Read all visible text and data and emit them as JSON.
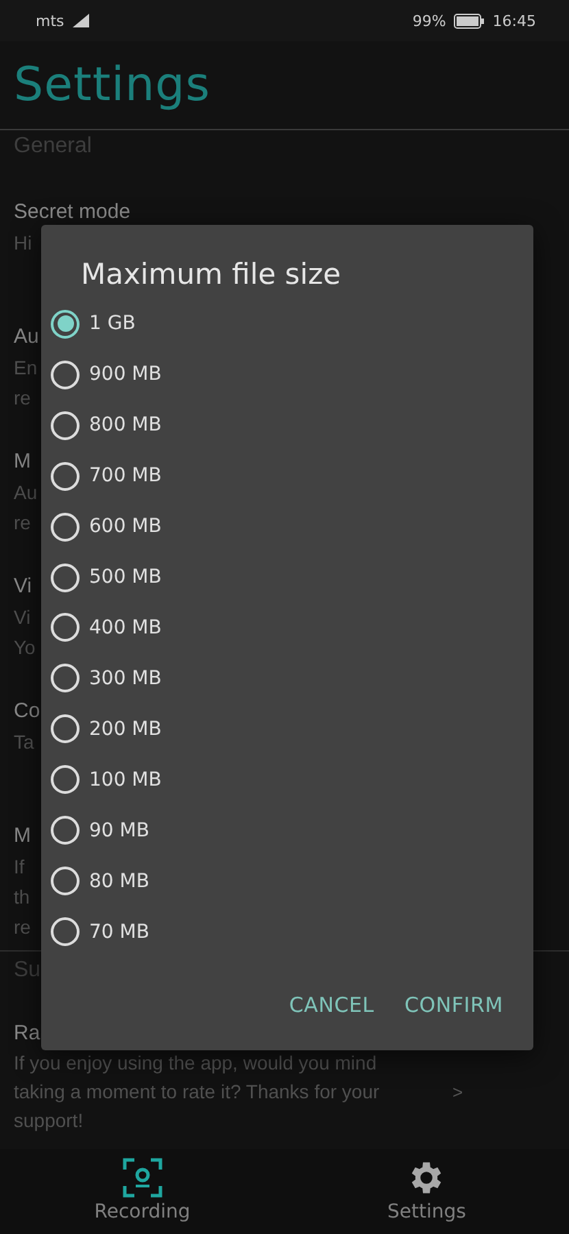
{
  "status_bar": {
    "carrier": "mts",
    "battery": "99%",
    "time": "16:45"
  },
  "header": {
    "title": "Settings"
  },
  "section": "General",
  "items": [
    {
      "title": "Secret mode",
      "lines": [
        "Hi"
      ]
    },
    {
      "title": "Au",
      "lines": [
        "En",
        "re"
      ]
    },
    {
      "title": "M",
      "lines": [
        "Au",
        "re"
      ]
    },
    {
      "title": "Vi",
      "lines": [
        "Vi",
        "Yo"
      ]
    },
    {
      "title": "Co",
      "lines": [
        "Ta"
      ]
    },
    {
      "title": "M",
      "lines": [
        "If",
        "th",
        "re"
      ]
    }
  ],
  "section_2": "Su",
  "rate": {
    "title": "Ra",
    "text": "If you enjoy using the app, would you mind taking a moment to rate it? Thanks for your support!",
    "chevron": ">"
  },
  "dialog": {
    "title": "Maximum file size",
    "options": [
      {
        "label": "1 GB",
        "selected": true
      },
      {
        "label": "900 MB",
        "selected": false
      },
      {
        "label": "800 MB",
        "selected": false
      },
      {
        "label": "700 MB",
        "selected": false
      },
      {
        "label": "600 MB",
        "selected": false
      },
      {
        "label": "500 MB",
        "selected": false
      },
      {
        "label": "400 MB",
        "selected": false
      },
      {
        "label": "300 MB",
        "selected": false
      },
      {
        "label": "200 MB",
        "selected": false
      },
      {
        "label": "100 MB",
        "selected": false
      },
      {
        "label": "90 MB",
        "selected": false
      },
      {
        "label": "80 MB",
        "selected": false
      },
      {
        "label": "70 MB",
        "selected": false
      }
    ],
    "buttons": [
      "CANCEL",
      "CONFIRM"
    ]
  },
  "nav": [
    {
      "label": "Recording",
      "kind": "recording",
      "selected": true
    },
    {
      "label": "Settings",
      "kind": "settings",
      "selected": false
    }
  ]
}
